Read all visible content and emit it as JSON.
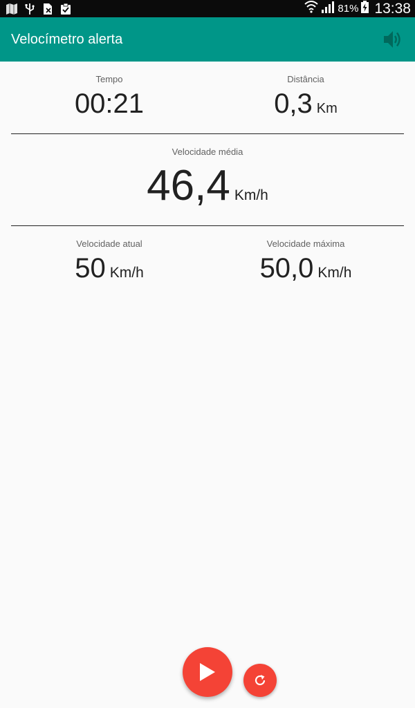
{
  "status_bar": {
    "battery_percent": "81%",
    "time": "13:38",
    "icons": [
      "maps-icon",
      "usb-icon",
      "no-sim-icon",
      "clipboard-check-icon",
      "wifi-icon",
      "signal-icon",
      "battery-charging-icon"
    ]
  },
  "app_bar": {
    "title": "Velocímetro alerta",
    "action_icon": "volume-icon"
  },
  "stats": {
    "time": {
      "label": "Tempo",
      "value": "00:21"
    },
    "distance": {
      "label": "Distância",
      "value": "0,3",
      "unit": "Km"
    },
    "avg_speed": {
      "label": "Velocidade média",
      "value": "46,4",
      "unit": "Km/h"
    },
    "current_speed": {
      "label": "Velocidade atual",
      "value": "50",
      "unit": "Km/h"
    },
    "max_speed": {
      "label": "Velocidade máxima",
      "value": "50,0",
      "unit": "Km/h"
    }
  },
  "actions": {
    "play_icon": "play-icon",
    "reset_icon": "refresh-icon"
  },
  "colors": {
    "primary": "#009688",
    "accent": "#f44336",
    "status_bar": "#0b0b0b",
    "background": "#fafafa",
    "text": "#212121"
  }
}
